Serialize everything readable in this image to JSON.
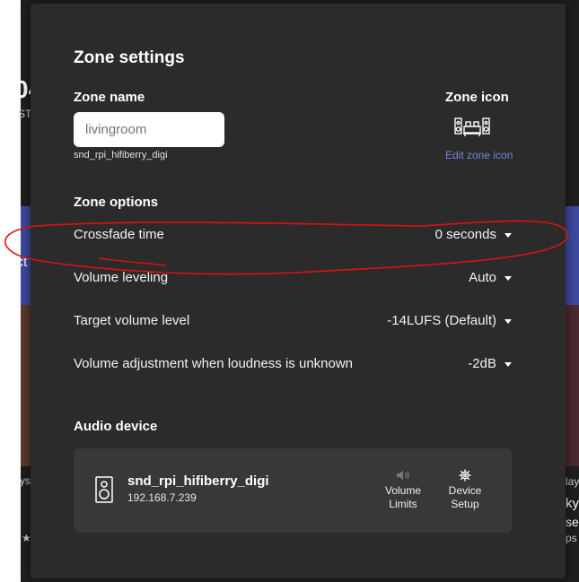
{
  "background": {
    "big_text": "04",
    "small_text_1": "ST",
    "small_text_2": "ct",
    "left_text_1": "ys",
    "left_text_2": "★",
    "right_text_1": "lay",
    "right_text_2": "kys",
    "right_text_3": "se",
    "right_text_4": "ps"
  },
  "modal": {
    "title": "Zone settings",
    "zone_name_label": "Zone name",
    "zone_name_placeholder": "livingroom",
    "zone_name_value": "",
    "device_id": "snd_rpi_hifiberry_digi",
    "zone_icon_label": "Zone icon",
    "zone_icon": "stereo-system-icon",
    "edit_zone_icon": "Edit zone icon",
    "zone_options_label": "Zone options",
    "options": [
      {
        "label": "Crossfade time",
        "value": "0 seconds"
      },
      {
        "label": "Volume leveling",
        "value": "Auto"
      },
      {
        "label": "Target volume level",
        "value": "-14LUFS (Default)"
      },
      {
        "label": "Volume adjustment when loudness is unknown",
        "value": "-2dB"
      }
    ],
    "audio_device_label": "Audio device",
    "device": {
      "icon": "speaker-icon",
      "name": "snd_rpi_hifiberry_digi",
      "ip": "192.168.7.239",
      "volume_limits_icon": "volume-icon",
      "volume_limits_label_1": "Volume",
      "volume_limits_label_2": "Limits",
      "device_setup_icon": "gear-icon",
      "device_setup_label_1": "Device",
      "device_setup_label_2": "Setup"
    }
  },
  "colors": {
    "modal_bg": "#2b2b2b",
    "card_bg": "#383838",
    "link": "#7b80e0",
    "annotation": "#e01010"
  }
}
